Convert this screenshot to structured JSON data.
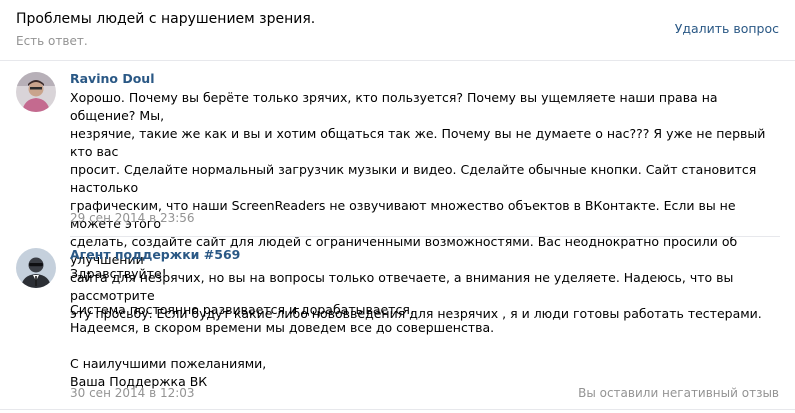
{
  "question": {
    "title": "Проблемы людей с нарушением зрения.",
    "status": "Есть ответ.",
    "delete_label": "Удалить вопрос"
  },
  "posts": [
    {
      "author": "Ravino Doul",
      "lines": [
        "Хорошо. Почему вы берёте только зрячих, кто пользуется? Почему вы ущемляете наши права на общение? Мы,",
        "незрячие, такие же как и вы и хотим общаться так же. Почему вы не думаете о нас??? Я уже не первый кто вас",
        "просит. Сделайте нормальный загрузчик музыки и видео. Сделайте обычные кнопки. Сайт становится настолько",
        "графическим, что наши ScreenReaders не озвучивают множество объектов в ВКонтакте. Если вы не можете этого",
        "сделать, создайте сайт для людей с ограниченными возможностями. Вас неоднократно просили об улучшении",
        "сайта для незрячих, но вы на вопросы только отвечаете, а внимания не уделяете. Надеюсь, что вы рассмотрите",
        "эту просьбу. Если будут какие либо нововведения для незрячих , я и люди готовы работать тестерами."
      ],
      "date": "29 сен 2014 в 23:56"
    },
    {
      "author": "Агент поддержки #569",
      "lines": [
        "Здравствуйте!",
        "",
        "Система постоянно развивается и дорабатывается.",
        "Надеемся, в скором времени мы доведем все до совершенства.",
        "",
        "С наилучшими пожеланиями,",
        "Ваша Поддержка ВК"
      ],
      "date": "30 сен 2014 в 12:03",
      "feedback": "Вы оставили негативный отзыв"
    }
  ],
  "colors": {
    "link": "#2a5885",
    "muted": "#939393",
    "divider": "#e7e8ec"
  }
}
